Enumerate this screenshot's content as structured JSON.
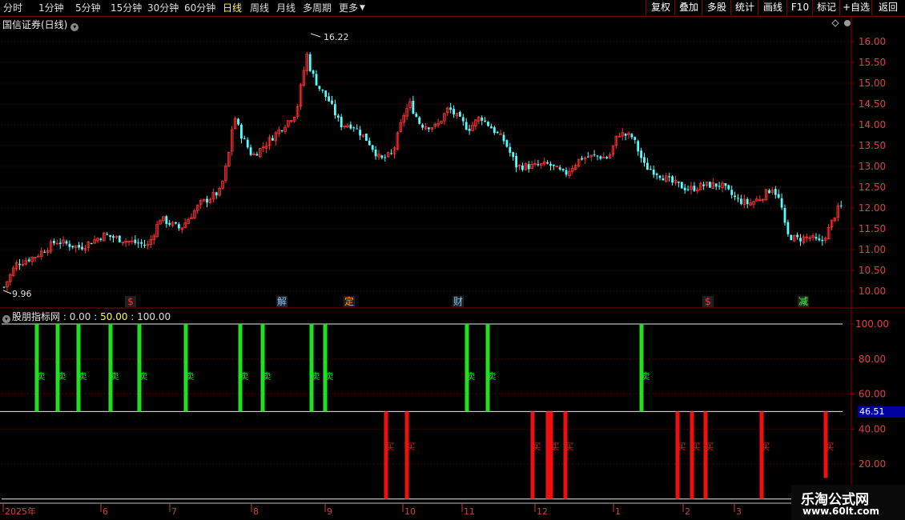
{
  "toolbar": {
    "periods": [
      "分时",
      "1分钟",
      "5分钟",
      "15分钟",
      "30分钟",
      "60分钟",
      "日线",
      "周线",
      "月线",
      "多周期",
      "更多"
    ],
    "active_period": "日线",
    "right_buttons": [
      "复权",
      "叠加",
      "多股",
      "统计",
      "画线",
      "F10",
      "标记",
      "+自选",
      "返回"
    ]
  },
  "main_chart": {
    "title": "国信证券(日线)",
    "high_label": "16.22",
    "low_label": "9.96",
    "y_ticks": [
      "16.00",
      "15.50",
      "15.00",
      "14.50",
      "14.00",
      "13.50",
      "13.00",
      "12.50",
      "12.00",
      "11.50",
      "11.00",
      "10.50",
      "10.00"
    ],
    "markers": [
      {
        "text": "$",
        "color": "#ff3030"
      },
      {
        "text": "解",
        "color": "#80c0ff"
      },
      {
        "text": "定",
        "color": "#ffa000"
      },
      {
        "text": "财",
        "color": "#80c0ff"
      },
      {
        "text": "$",
        "color": "#ff3030"
      },
      {
        "text": "减",
        "color": "#40ff40"
      }
    ]
  },
  "indicator": {
    "name": "股朋指标网",
    "values": [
      "0.00",
      "50.00",
      "100.00"
    ],
    "current_value": "46.51",
    "y_ticks": [
      "100.00",
      "80.00",
      "60.00",
      "40.00",
      "20.00"
    ],
    "sell_label": "卖",
    "buy_label": "买"
  },
  "x_axis": {
    "labels": [
      "2025年",
      "6",
      "7",
      "8",
      "9",
      "10",
      "11",
      "12",
      "1",
      "2",
      "3"
    ]
  },
  "watermark": {
    "line1": "乐淘公式网",
    "line2": "www.60lt.com"
  },
  "colors": {
    "up": "#ff3232",
    "down": "#54ffff",
    "sell": "#20e020",
    "buy": "#ee1010",
    "grid": "#8a0000"
  }
}
